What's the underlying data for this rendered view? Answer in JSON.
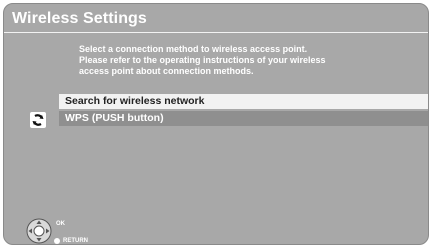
{
  "window": {
    "title": "Wireless Settings"
  },
  "instructions": {
    "lines": [
      "Select a connection method to wireless access point.",
      "Please refer to the operating instructions of your wireless",
      "access point about connection methods."
    ]
  },
  "menu": {
    "items": [
      {
        "label": "Search for wireless network",
        "selected": true
      },
      {
        "label": "WPS (PUSH button)",
        "selected": false
      }
    ]
  },
  "footer": {
    "ok_label": "OK",
    "return_label": "RETURN"
  },
  "icons": {
    "wps": "wps-icon",
    "dpad": "dpad-icon",
    "return": "return-button-icon"
  },
  "colors": {
    "background": "#a8a8a8",
    "selected_row": "#f2f2f2",
    "unselected_row": "#8f8f8f",
    "text": "#ffffff"
  }
}
